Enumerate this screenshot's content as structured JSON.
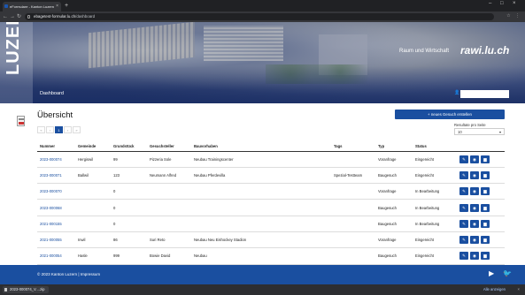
{
  "browser": {
    "tab_title": "eFormulare - Kanton Luzern",
    "tab_close": "×",
    "new_tab": "+",
    "url_host": "ebagetest-formular.lu.ch",
    "url_path": "/dashboard",
    "window_controls": [
      "–",
      "□",
      "×"
    ]
  },
  "header": {
    "logo": "LUZERN",
    "brand_subtitle": "Raum und Wirtschaft",
    "brand_logo": "rawi.lu.ch",
    "title": "Dashboard",
    "user_name": ""
  },
  "main": {
    "heading": "Übersicht",
    "new_request_button": "neues Gesuch erstellen",
    "pagination": [
      "«",
      "‹",
      "1",
      "›",
      "»"
    ],
    "results_per_page_label": "Resultate pro Seite",
    "results_per_page_value": "10"
  },
  "table": {
    "columns": [
      "Nummer",
      "Gemeinde",
      "Grundstück",
      "Gesuchsteller",
      "Bauvorhaben",
      "Tags",
      "Typ",
      "Status"
    ],
    "rows": [
      {
        "nummer": "2023-000074",
        "gemeinde": "Hergiswil",
        "grundstueck": "99",
        "gesuchsteller": "Pizzeria Sole",
        "bauvorhaben": "Neubau Trainingscenter",
        "tags": "",
        "typ": "Voranfrage",
        "status": "Eingereicht"
      },
      {
        "nummer": "2023-000071",
        "gemeinde": "Ballwil",
        "grundstueck": "123",
        "gesuchsteller": "Neumann Alfred",
        "bauvorhaben": "Neubau Pferdevilla",
        "tags": "Spezial-Testteam",
        "typ": "Baugesuch",
        "status": "Eingereicht"
      },
      {
        "nummer": "2023-000070",
        "gemeinde": "",
        "grundstueck": "0",
        "gesuchsteller": "",
        "bauvorhaben": "",
        "tags": "",
        "typ": "Voranfrage",
        "status": "In Bearbeitung"
      },
      {
        "nummer": "2023-000068",
        "gemeinde": "",
        "grundstueck": "0",
        "gesuchsteller": "",
        "bauvorhaben": "",
        "tags": "",
        "typ": "Baugesuch",
        "status": "In Bearbeitung"
      },
      {
        "nummer": "2021-000155",
        "gemeinde": "",
        "grundstueck": "0",
        "gesuchsteller": "",
        "bauvorhaben": "",
        "tags": "",
        "typ": "Baugesuch",
        "status": "In Bearbeitung"
      },
      {
        "nummer": "2021-000055",
        "gemeinde": "Inwil",
        "grundstueck": "86",
        "gesuchsteller": "Suri Reto",
        "bauvorhaben": "Neubau Neu Eishockey Stadion",
        "tags": "",
        "typ": "Voranfrage",
        "status": "Eingereicht"
      },
      {
        "nummer": "2021-000054",
        "gemeinde": "Hasle",
        "grundstueck": "999",
        "gesuchsteller": "Bowie David",
        "bauvorhaben": "Neubau",
        "tags": "",
        "typ": "Baugesuch",
        "status": "Eingereicht"
      }
    ],
    "row_actions": [
      {
        "icon": "edit-icon",
        "glyph": "✎"
      },
      {
        "icon": "eye-icon",
        "glyph": "◉"
      },
      {
        "icon": "trash-icon",
        "glyph": "▆"
      }
    ]
  },
  "footer": {
    "copyright": "© 2023 Kanton Luzern",
    "separator": "|",
    "impressum": "Impressum",
    "social": [
      "▶",
      "🐦"
    ]
  },
  "downloads": {
    "file": "2023-000074_V....zip",
    "show_all": "Alle anzeigen",
    "close": "×"
  },
  "colors": {
    "primary": "#1a4fa0"
  }
}
